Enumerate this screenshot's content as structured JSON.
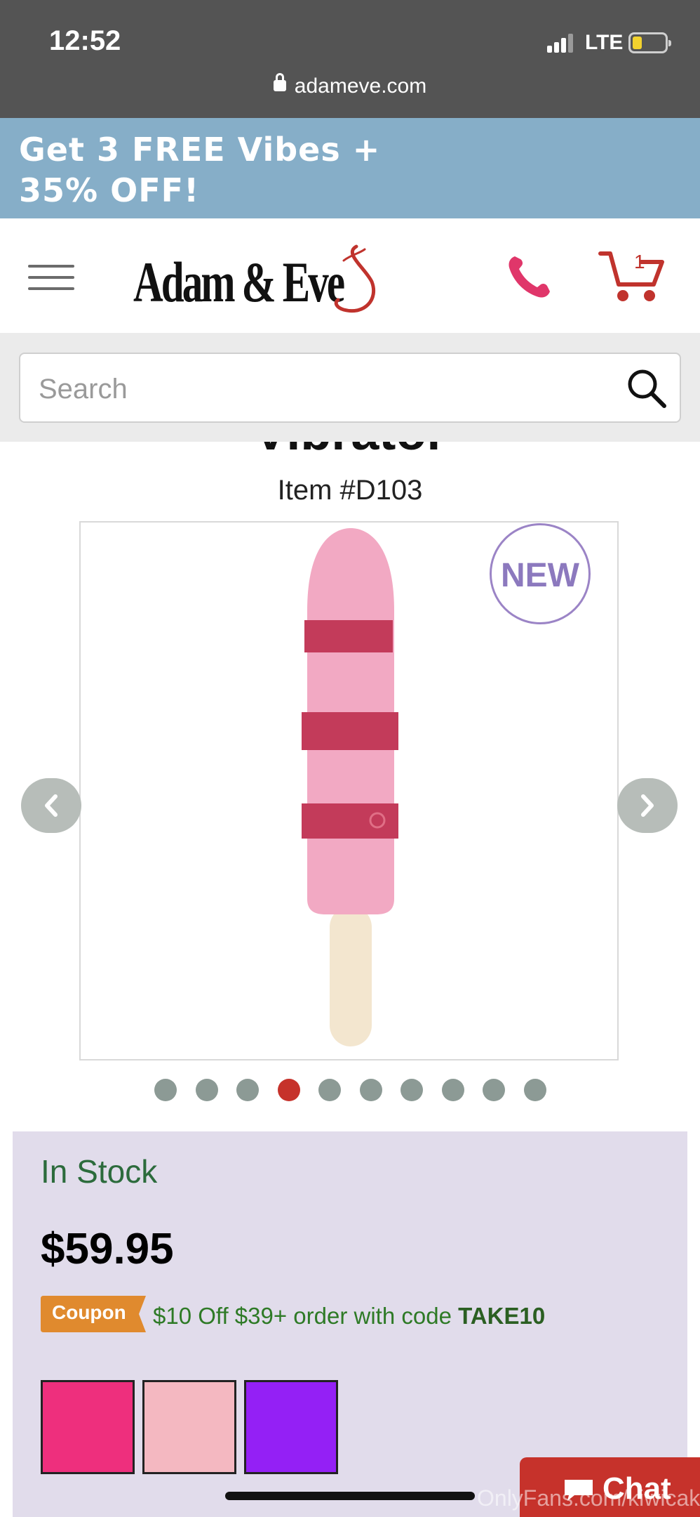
{
  "status_bar": {
    "time": "12:52",
    "network": "LTE",
    "url": "adameve.com"
  },
  "promo": {
    "text": "Get 3 FREE Vibes + 35% OFF!",
    "background": "#86aec8"
  },
  "header": {
    "logo_text": "Adam & Eve",
    "cart_count": "1",
    "accent_color": "#c0332d"
  },
  "search": {
    "placeholder": "Search"
  },
  "product": {
    "title_partial": "Vibrator",
    "item_number": "Item #D103",
    "badge": "NEW",
    "carousel": {
      "total": 10,
      "active_index": 3
    }
  },
  "info": {
    "stock": "In Stock",
    "price": "$59.95",
    "coupon_label": "Coupon",
    "coupon_text": "$10 Off $39+ order with code ",
    "coupon_code": "TAKE10",
    "swatches": [
      "#ee2f7d",
      "#f4b8c1",
      "#9420f5"
    ]
  },
  "chat": {
    "label": "Chat"
  },
  "watermark": "OnlyFans.com/kiwicake"
}
